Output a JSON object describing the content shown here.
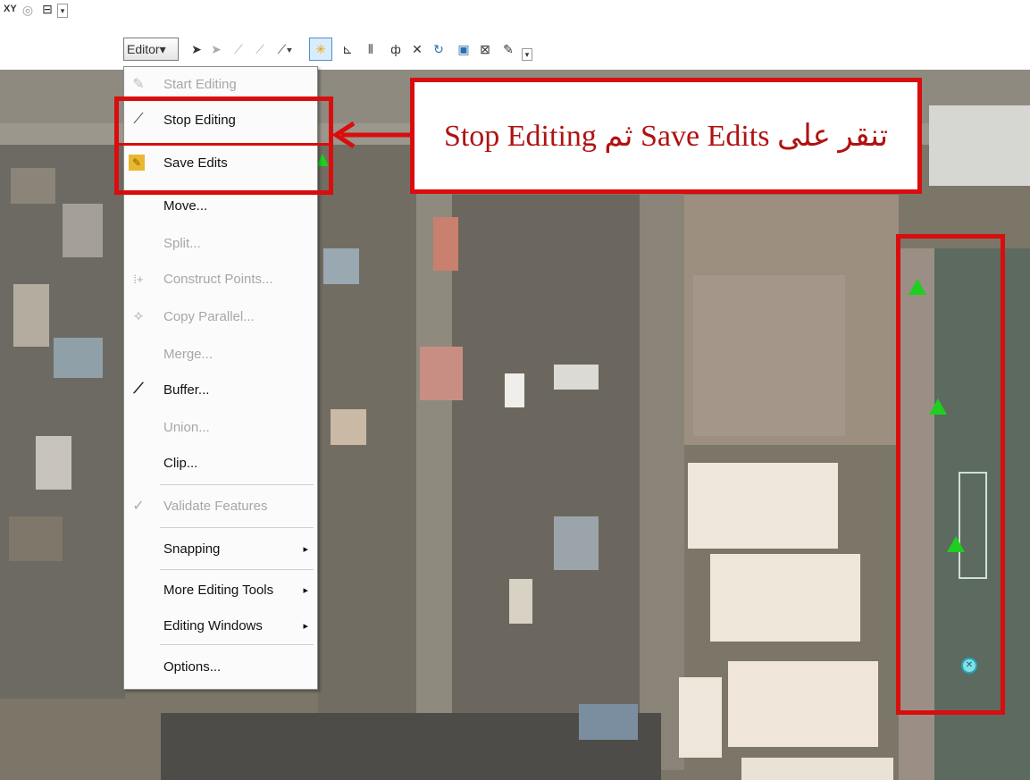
{
  "top_toolbar": {
    "xy_label": "XY"
  },
  "editor_toolbar": {
    "editor_label": "Editor▾"
  },
  "menu": {
    "items": [
      {
        "label": "Start Editing",
        "disabled": true,
        "icon": "start-editing-icon"
      },
      {
        "label": "Stop Editing",
        "disabled": false,
        "icon": "stop-editing-icon"
      },
      {
        "label": "Save Edits",
        "disabled": false,
        "icon": "save-edits-icon"
      },
      {
        "label": "Move...",
        "disabled": false,
        "icon": ""
      },
      {
        "label": "Split...",
        "disabled": true,
        "icon": ""
      },
      {
        "label": "Construct Points...",
        "disabled": true,
        "icon": "construct-points-icon"
      },
      {
        "label": "Copy Parallel...",
        "disabled": true,
        "icon": "copy-parallel-icon"
      },
      {
        "label": "Merge...",
        "disabled": true,
        "icon": ""
      },
      {
        "label": "Buffer...",
        "disabled": false,
        "icon": "buffer-icon"
      },
      {
        "label": "Union...",
        "disabled": true,
        "icon": ""
      },
      {
        "label": "Clip...",
        "disabled": false,
        "icon": ""
      },
      {
        "label": "Validate Features",
        "disabled": true,
        "icon": "validate-features-icon"
      },
      {
        "label": "Snapping",
        "disabled": false,
        "submenu": true
      },
      {
        "label": "More Editing Tools",
        "disabled": false,
        "submenu": true
      },
      {
        "label": "Editing Windows",
        "disabled": false,
        "submenu": true
      },
      {
        "label": "Options...",
        "disabled": false
      }
    ],
    "submenu_arrow": "▸"
  },
  "callout": {
    "text": "تنقر على Save Edits ثم Stop Editing"
  },
  "colors": {
    "highlight_red": "#d90d0d",
    "point_green": "#1fce20"
  }
}
